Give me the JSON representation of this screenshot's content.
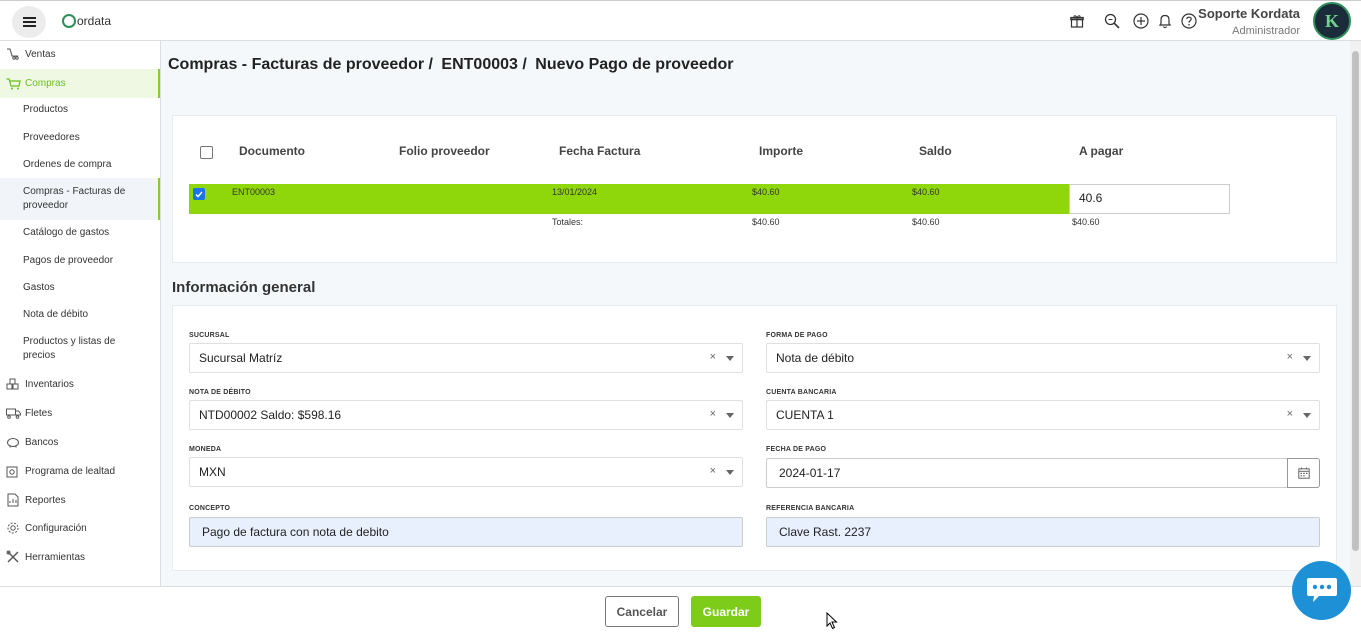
{
  "header": {
    "brand": "ordata",
    "user_name": "Soporte Kordata",
    "user_role": "Administrador",
    "avatar_letter": "K",
    "icons": [
      "gift-icon",
      "search-zoom-icon",
      "add-circle-icon",
      "bell-icon",
      "help-icon"
    ]
  },
  "sidebar": {
    "items": [
      {
        "label": "Ventas",
        "icon": "sales-icon"
      },
      {
        "label": "Compras",
        "icon": "cart-icon"
      },
      {
        "label": "Inventarios",
        "icon": "inventory-icon"
      },
      {
        "label": "Fletes",
        "icon": "truck-icon"
      },
      {
        "label": "Bancos",
        "icon": "piggy-bank-icon"
      },
      {
        "label": "Programa de lealtad",
        "icon": "loyalty-icon"
      },
      {
        "label": "Reportes",
        "icon": "report-icon"
      },
      {
        "label": "Configuración",
        "icon": "gear-icon"
      },
      {
        "label": "Herramientas",
        "icon": "tools-icon"
      }
    ],
    "subitems": [
      "Productos",
      "Proveedores",
      "Ordenes de compra",
      "Compras - Facturas de proveedor",
      "Catálogo de gastos",
      "Pagos de proveedor",
      "Gastos",
      "Nota de débito",
      "Productos y listas de precios"
    ]
  },
  "breadcrumb": {
    "part1": "Compras - Facturas de proveedor /",
    "part2": "ENT00003 /",
    "part3": "Nuevo Pago de proveedor"
  },
  "table": {
    "headers": [
      "Documento",
      "Folio proveedor",
      "Fecha Factura",
      "Importe",
      "Saldo",
      "A pagar"
    ],
    "row": {
      "documento": "ENT00003",
      "folio": "",
      "fecha": "13/01/2024",
      "importe": "$40.60",
      "saldo": "$40.60",
      "a_pagar": "40.6"
    },
    "totals": {
      "label": "Totales:",
      "importe": "$40.60",
      "saldo": "$40.60",
      "a_pagar": "$40.60"
    }
  },
  "form": {
    "section_title": "Información general",
    "sucursal": {
      "label": "SUCURSAL",
      "value": "Sucursal Matríz"
    },
    "forma_pago": {
      "label": "FORMA DE PAGO",
      "value": "Nota de débito"
    },
    "nota_debito": {
      "label": "NOTA DE DÉBITO",
      "value": "NTD00002 Saldo: $598.16"
    },
    "cuenta_bancaria": {
      "label": "CUENTA BANCARIA",
      "value": "CUENTA 1"
    },
    "moneda": {
      "label": "MONEDA",
      "value": "MXN"
    },
    "fecha_pago": {
      "label": "FECHA DE PAGO",
      "value": "2024-01-17"
    },
    "concepto": {
      "label": "CONCEPTO",
      "value": "Pago de factura con nota de debito"
    },
    "referencia": {
      "label": "REFERENCIA BANCARIA",
      "value": "Clave Rast. 2237"
    },
    "clear_glyph": "×"
  },
  "footer": {
    "cancel_label": "Cancelar",
    "save_label": "Guardar"
  },
  "colors": {
    "accent_green": "#7ccc19",
    "row_green": "#8fd60a",
    "checkbox_blue": "#1a73e8",
    "chat_blue": "#1e90d6"
  }
}
